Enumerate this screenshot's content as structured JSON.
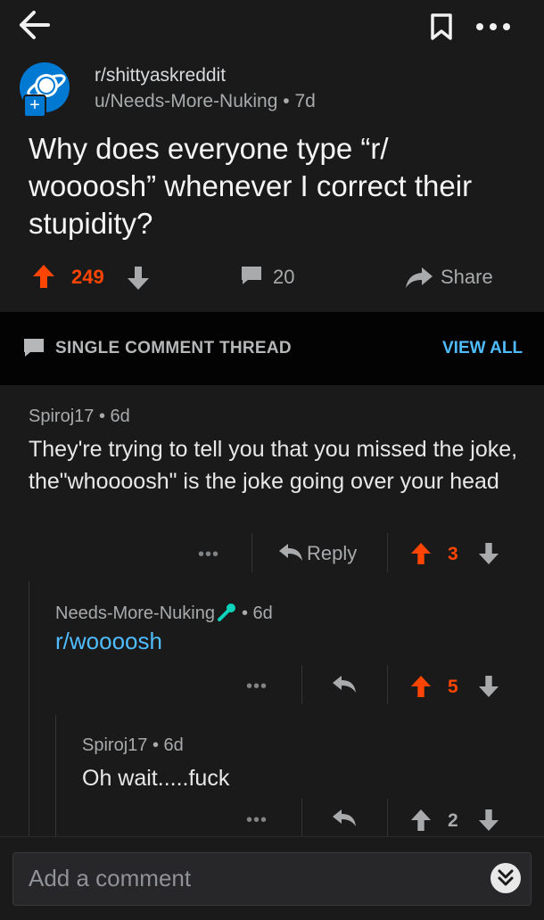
{
  "icons": {
    "back": "back-arrow-icon",
    "save": "bookmark-icon",
    "more": "more-icon",
    "upvote": "upvote-arrow-icon",
    "downvote": "downvote-arrow-icon",
    "comment": "comment-bubble-icon",
    "share": "share-arrow-icon",
    "reply": "reply-arrow-icon",
    "expand": "chevron-down-double-icon"
  },
  "colors": {
    "upvote": "#ff4500",
    "link": "#4fbcff",
    "background": "#1a1a1b"
  },
  "post": {
    "subreddit": "r/shittyaskreddit",
    "author": "u/Needs-More-Nuking",
    "age": "7d",
    "title": "Why does everyone type “r/ woooosh” whenever I correct their stupidity?",
    "score": "249",
    "comments": "20",
    "share_label": "Share"
  },
  "thread": {
    "label": "SINGLE COMMENT THREAD",
    "view_all": "VIEW ALL"
  },
  "comments": [
    {
      "author": "Spiroj17",
      "age": "6d",
      "body": "They're trying to tell you that you missed the joke, the\"whoooosh\" is the joke going over your head",
      "more": "•••",
      "reply_label": "Reply",
      "score": "3"
    },
    {
      "author": "Needs-More-Nuking",
      "age": "6d",
      "body": "r/woooosh",
      "more": "•••",
      "score": "5"
    },
    {
      "author": "Spiroj17",
      "age": "6d",
      "body": "Oh wait.....fuck",
      "more": "•••",
      "score": "2"
    }
  ],
  "composer": {
    "placeholder": "Add a comment"
  },
  "sep": "•"
}
